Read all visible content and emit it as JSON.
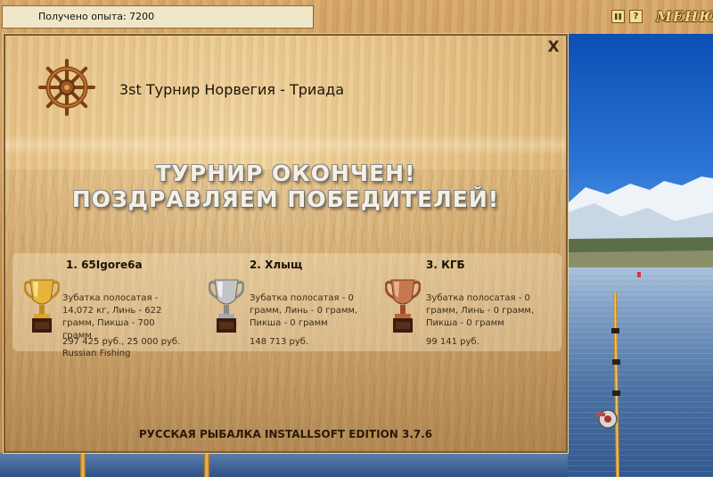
{
  "top_bar": {
    "xp_text": "Получено опыта: 7200",
    "pause_icon": "pause-icon",
    "help_label": "?",
    "menu_label": "МЕНЮ"
  },
  "dialog": {
    "close_label": "X",
    "tournament_name": "3st Турнир Норвегия - Триада",
    "banner_line1": "ТУРНИР ОКОНЧЕН!",
    "banner_line2": "ПОЗДРАВЛЯЕМ ПОБЕДИТЕЛЕЙ!",
    "winners": [
      {
        "place": "1. 65Igore6a",
        "catch": "Зубатка полосатая - 14,072 кг, Линь - 622 грамм, Пикша - 700 грамм",
        "prize": "297 425 руб., 25 000 руб. Russian Fishing",
        "trophy": "gold",
        "color": "#d9a32c"
      },
      {
        "place": "2. Хлыщ",
        "catch": "Зубатка полосатая - 0 грамм, Линь - 0 грамм, Пикша - 0 грамм",
        "prize": "148 713 руб.",
        "trophy": "silver",
        "color": "#b9b9b9"
      },
      {
        "place": "3. КГБ",
        "catch": "Зубатка полосатая - 0 грамм, Линь - 0 грамм, Пикша - 0 грамм",
        "prize": "99 141 руб.",
        "trophy": "bronze",
        "color": "#c0714a"
      }
    ],
    "footer": "РУССКАЯ РЫБАЛКА INSTALLSOFT EDITION 3.7.6"
  }
}
